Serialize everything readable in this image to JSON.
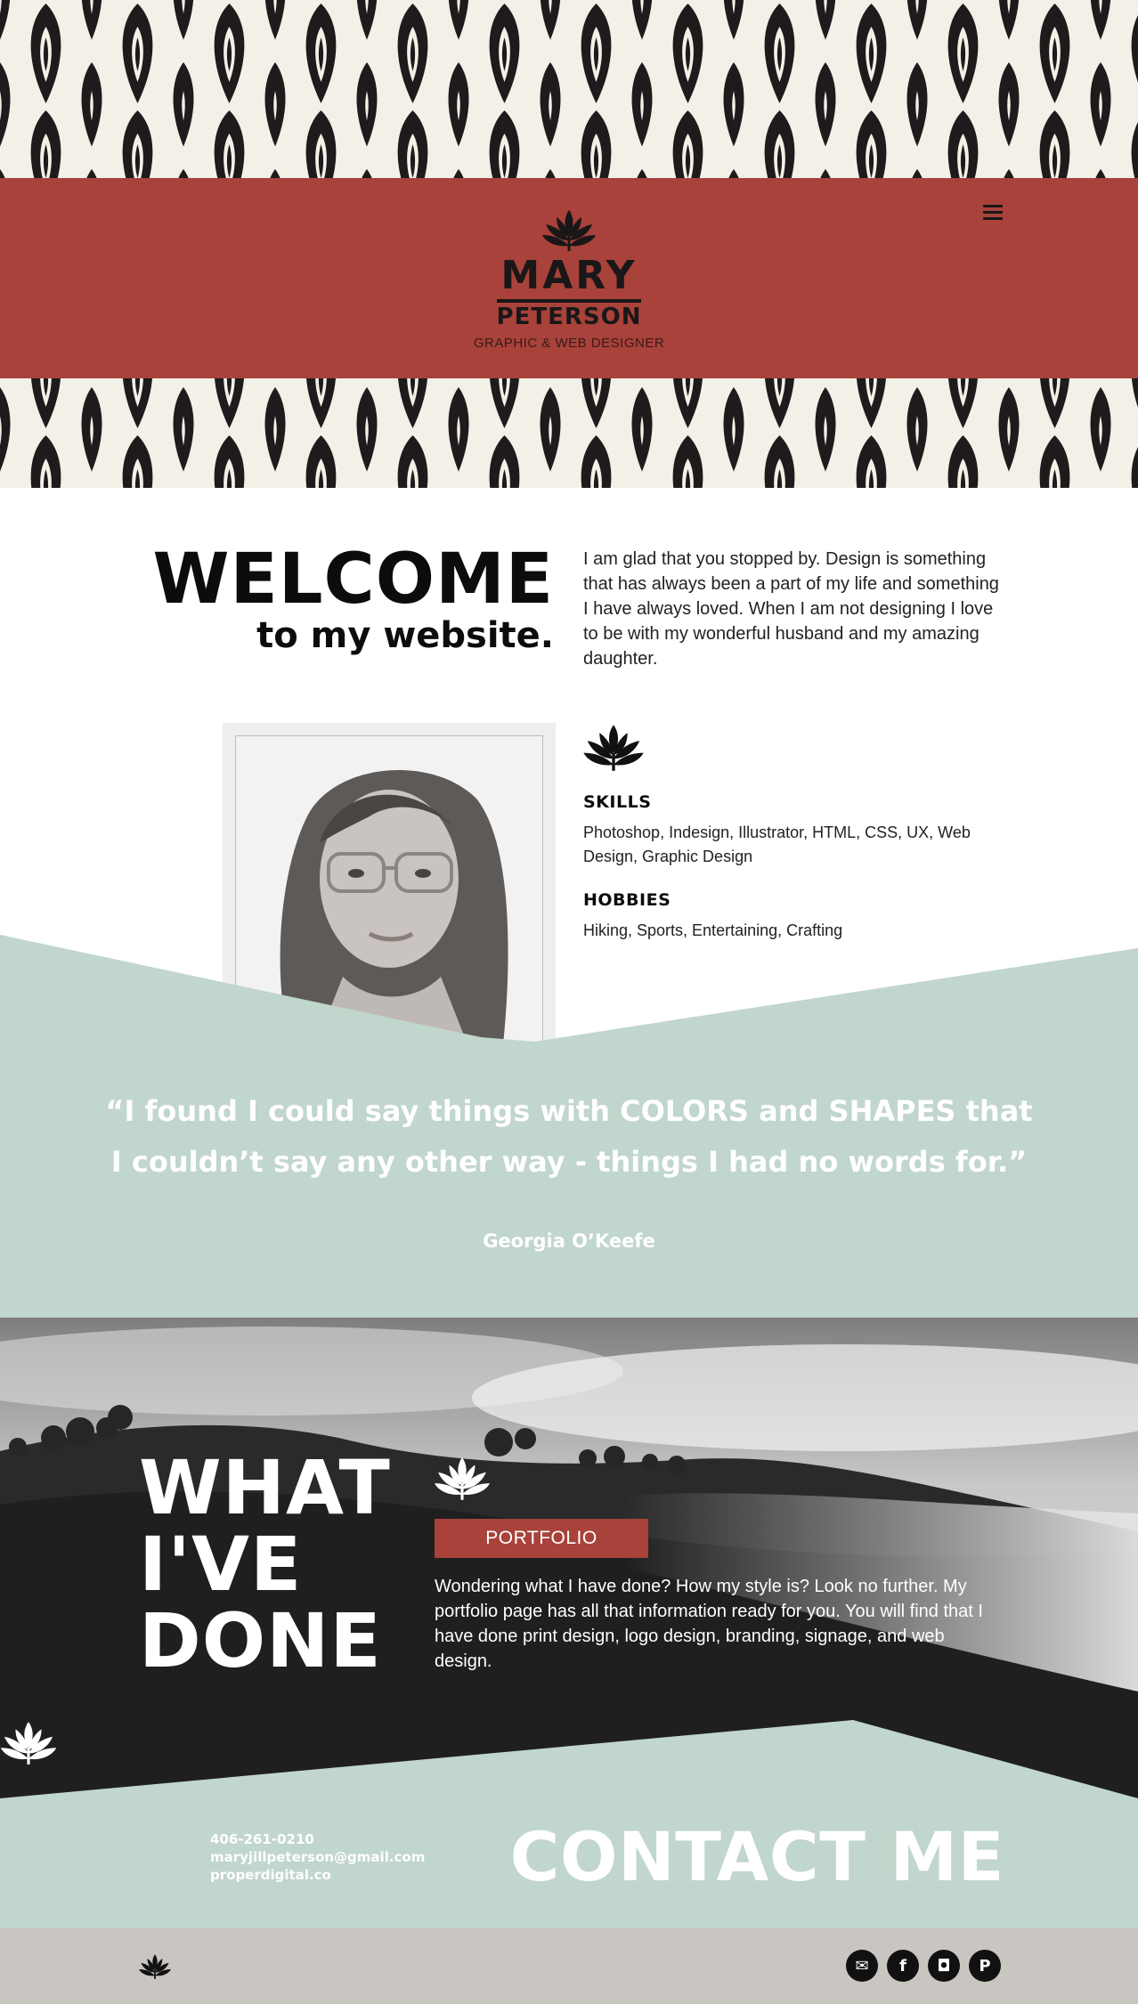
{
  "header": {
    "first_name": "MARY",
    "last_name": "PETERSON",
    "tagline": "GRAPHIC & WEB DESIGNER",
    "menu_icon": "hamburger-icon"
  },
  "welcome": {
    "title": "WELCOME",
    "subtitle": "to my website.",
    "intro": "I am glad that you stopped by. Design is something that has always been a part of my life and something I have always loved. When I am not designing I love to be with my wonderful husband and my amazing daughter."
  },
  "about": {
    "skills_heading": "SKILLS",
    "skills_text": "Photoshop, Indesign, Illustrator, HTML, CSS, UX, Web Design, Graphic Design",
    "hobbies_heading": "HOBBIES",
    "hobbies_text": "Hiking, Sports, Entertaining, Crafting"
  },
  "quote": {
    "text": "“I found I could say things with COLORS and SHAPES that I couldn’t say any other way - things I had no words for.”",
    "author": "Georgia O’Keefe"
  },
  "portfolio": {
    "title_line1": "WHAT",
    "title_line2": "I'VE",
    "title_line3": "DONE",
    "button_label": "PORTFOLIO",
    "text": "Wondering what I have done? How my style is? Look no further. My portfolio page has all that information ready for you. You will find that I have done print design, logo design, branding, signage, and web design."
  },
  "contact": {
    "phone": "406-261-0210",
    "email": "maryjillpeterson@gmail.com",
    "website": "properdigital.co",
    "title": "CONTACT ME"
  },
  "footer": {
    "social": [
      {
        "icon": "email-icon",
        "glyph": "✉"
      },
      {
        "icon": "facebook-icon",
        "glyph": "f"
      },
      {
        "icon": "instagram-icon",
        "glyph": "◘"
      },
      {
        "icon": "pinterest-icon",
        "glyph": "P"
      }
    ]
  },
  "colors": {
    "brand_red": "#a8423a",
    "mint": "#c1d6cc",
    "pattern_dark": "#1f1b1c",
    "pattern_light": "#f3f0e8",
    "footer_gray": "#c9c5c0"
  }
}
